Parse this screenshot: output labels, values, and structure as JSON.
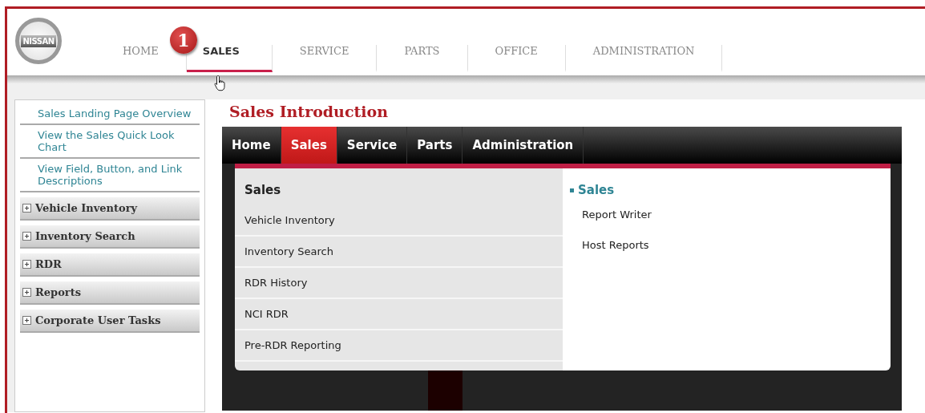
{
  "logo": {
    "text": "NISSAN"
  },
  "top_nav": [
    {
      "label": "HOME",
      "selected": false
    },
    {
      "label": "SALES",
      "selected": true
    },
    {
      "label": "SERVICE",
      "selected": false
    },
    {
      "label": "PARTS",
      "selected": false
    },
    {
      "label": "OFFICE",
      "selected": false
    },
    {
      "label": "ADMINISTRATION",
      "selected": false
    }
  ],
  "step_badge": "1",
  "sidebar": {
    "links": [
      "Sales Landing Page Overview",
      "View the Sales Quick Look Chart",
      "View Field, Button, and Link Descriptions"
    ],
    "sections": [
      {
        "label": "Vehicle Inventory",
        "expanded": false
      },
      {
        "label": "Inventory Search",
        "expanded": false
      },
      {
        "label": "RDR",
        "expanded": false
      },
      {
        "label": "Reports",
        "expanded": false
      },
      {
        "label": "Corporate User Tasks",
        "expanded": false
      }
    ]
  },
  "page_title": "Sales Introduction",
  "menu": {
    "tabs": [
      {
        "label": "Home",
        "selected": false
      },
      {
        "label": "Sales",
        "selected": true
      },
      {
        "label": "Service",
        "selected": false
      },
      {
        "label": "Parts",
        "selected": false
      },
      {
        "label": "Administration",
        "selected": false
      }
    ],
    "dropdown": {
      "heading": "Sales",
      "items": [
        "Vehicle Inventory",
        "Inventory Search",
        "RDR History",
        "NCI RDR",
        "Pre-RDR Reporting"
      ],
      "right_heading": "Sales",
      "right_items": [
        "Report Writer",
        "Host Reports"
      ]
    }
  }
}
